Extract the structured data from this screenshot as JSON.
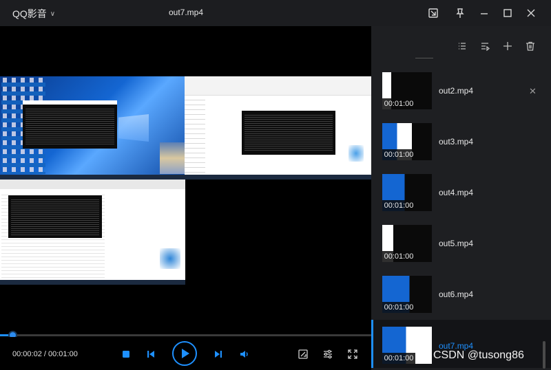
{
  "app": {
    "logo": "QQ影音",
    "window_title": "out7.mp4"
  },
  "titlebar_icons": [
    "screenshot-icon",
    "pin-icon",
    "minimize-icon",
    "maximize-icon",
    "close-icon"
  ],
  "player": {
    "time_current": "00:00:02",
    "time_separator": " / ",
    "time_total": "00:01:00",
    "progress": 0.033,
    "accent": "#1e90ff"
  },
  "playlist": {
    "tools": [
      "playlist-view-icon",
      "play-mode-icon",
      "add-icon",
      "trash-icon"
    ],
    "items": [
      {
        "name": "out2.mp4",
        "duration": "00:01:00",
        "active": false
      },
      {
        "name": "out3.mp4",
        "duration": "00:01:00",
        "active": false
      },
      {
        "name": "out4.mp4",
        "duration": "00:01:00",
        "active": false
      },
      {
        "name": "out5.mp4",
        "duration": "00:01:00",
        "active": false
      },
      {
        "name": "out6.mp4",
        "duration": "00:01:00",
        "active": false
      },
      {
        "name": "out7.mp4",
        "duration": "00:01:00",
        "active": true
      }
    ],
    "close_glyph": "✕"
  },
  "watermark": "CSDN @tusong86"
}
